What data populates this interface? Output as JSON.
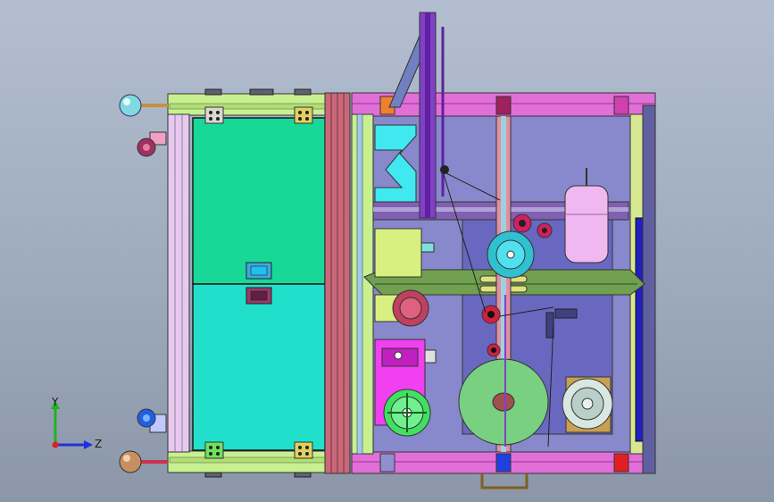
{
  "viewport": {
    "background_top": "#b3bfd0",
    "background_bottom": "#8b97a8"
  },
  "triad": {
    "y_label": "Y",
    "z_label": "Z",
    "y_color": "#1fb31f",
    "z_color": "#2030e0",
    "x_color": "#e02020"
  },
  "model": {
    "colors": {
      "frame_magenta": "#e070d8",
      "frame_green": "#c8f090",
      "panel_upper": "#18d898",
      "panel_lower": "#20e0cc",
      "purple_post": "#8040c8",
      "lavender_plate": "#6868c0",
      "accent_orange": "#f08030",
      "accent_red": "#e02020"
    },
    "icons": [
      "sphere-handle-icon",
      "caster-wheel-icon",
      "spool-icon",
      "motor-icon",
      "handwheel-icon",
      "gear-icon"
    ]
  }
}
